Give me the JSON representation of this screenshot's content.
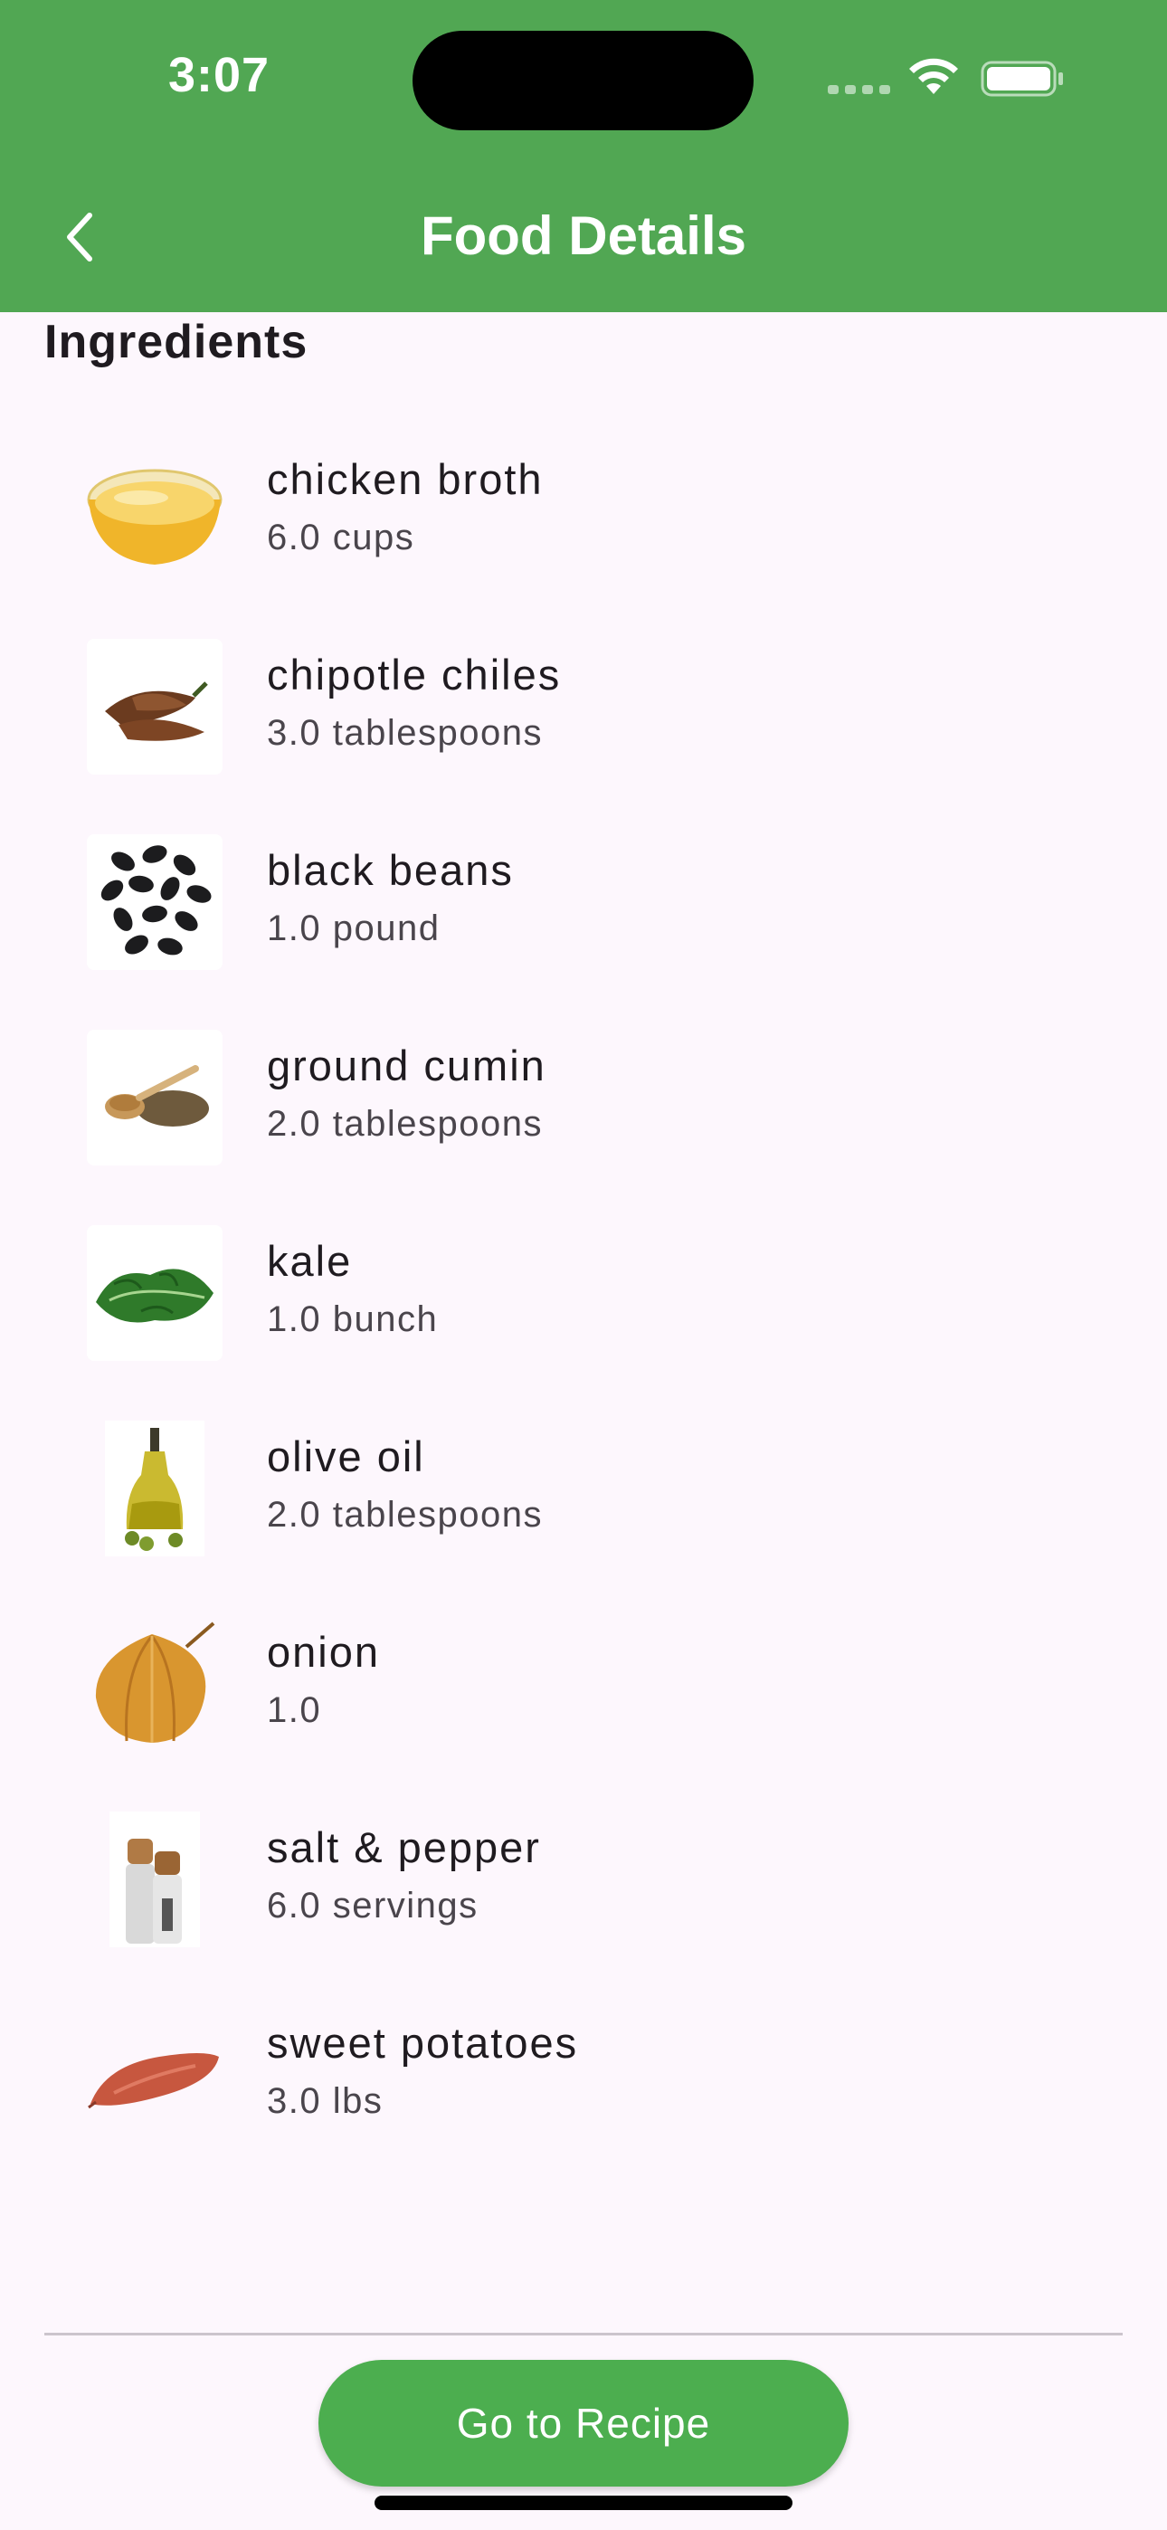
{
  "status_bar": {
    "time": "3:07"
  },
  "header": {
    "title": "Food Details",
    "back_icon": "chevron-left-icon"
  },
  "section": {
    "heading": "Ingredients"
  },
  "ingredients": [
    {
      "name": "chicken broth",
      "amount": "6.0 cups",
      "icon": "bowl-of-broth"
    },
    {
      "name": "chipotle chiles",
      "amount": "3.0 tablespoons",
      "icon": "dried-chiles"
    },
    {
      "name": "black beans",
      "amount": "1.0 pound",
      "icon": "black-beans"
    },
    {
      "name": "ground cumin",
      "amount": "2.0 tablespoons",
      "icon": "spoon-of-cumin"
    },
    {
      "name": "kale",
      "amount": "1.0 bunch",
      "icon": "kale-leaf"
    },
    {
      "name": "olive oil",
      "amount": "2.0 tablespoons",
      "icon": "olive-oil-bottle"
    },
    {
      "name": "onion",
      "amount": "1.0",
      "icon": "onion"
    },
    {
      "name": "salt & pepper",
      "amount": "6.0 servings",
      "icon": "salt-pepper-mills"
    },
    {
      "name": "sweet potatoes",
      "amount": "3.0 lbs",
      "icon": "sweet-potato"
    }
  ],
  "footer": {
    "button_label": "Go to Recipe"
  },
  "colors": {
    "header": "#51a753",
    "button": "#4cae4f",
    "background": "#fdf7fd"
  }
}
